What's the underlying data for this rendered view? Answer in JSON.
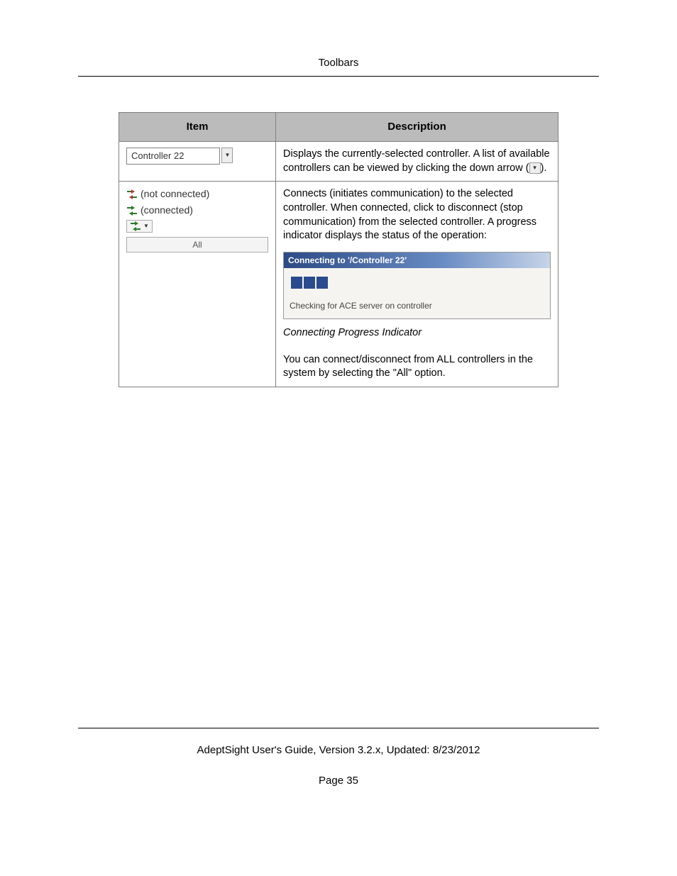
{
  "header": {
    "title": "Toolbars"
  },
  "table": {
    "headers": {
      "item": "Item",
      "description": "Description"
    },
    "rows": [
      {
        "item_controller_label": "Controller 22",
        "desc_part1": "Displays the currently-selected controller. A list of available controllers can be viewed by clicking the down arrow (",
        "desc_part2": ")."
      },
      {
        "item_not_connected": "(not connected)",
        "item_connected": "(connected)",
        "item_all": "All",
        "desc_intro": "Connects (initiates communication) to the selected controller. When connected, click to disconnect (stop communication) from the selected controller. A progress indicator displays the status of the operation:",
        "progress_title": "Connecting to '/Controller 22'",
        "progress_status": "Checking for ACE server on controller",
        "caption": "Connecting Progress Indicator",
        "desc_tail": "You can connect/disconnect from ALL controllers in the system by selecting the \"All\" option."
      }
    ]
  },
  "footer": {
    "line": "AdeptSight User's Guide,  Version 3.2.x, Updated: 8/23/2012",
    "page": "Page 35"
  }
}
